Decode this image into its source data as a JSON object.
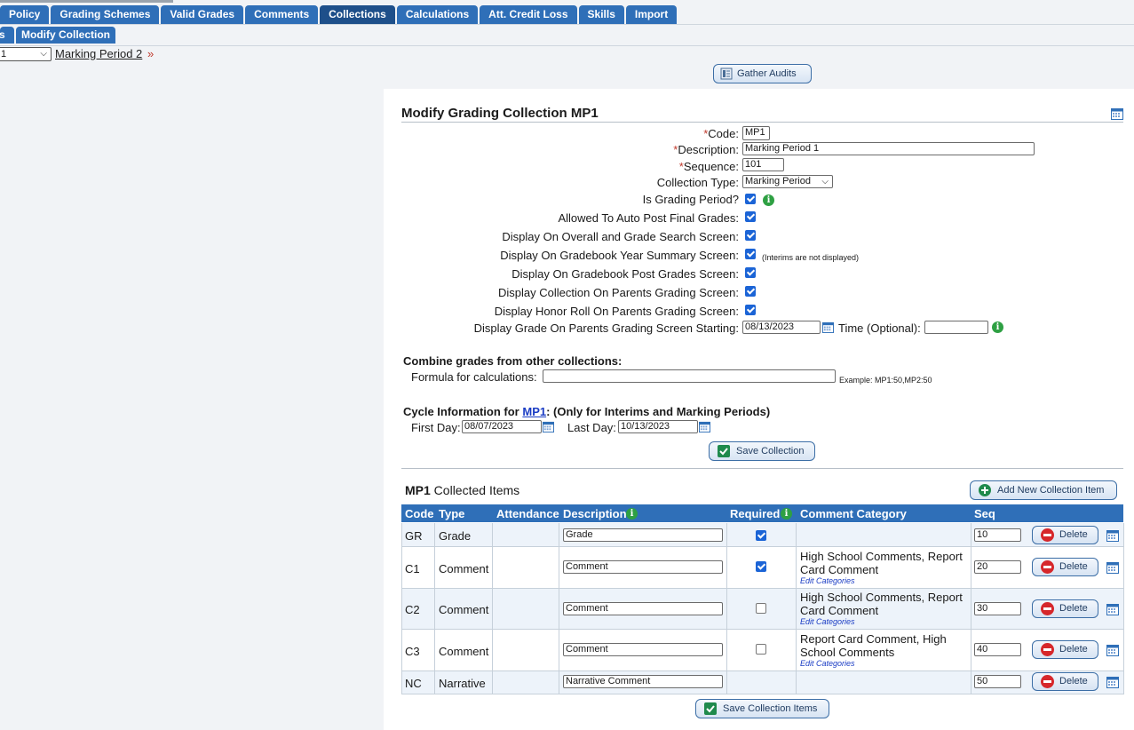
{
  "tabs": [
    "Policy",
    "Grading Schemes",
    "Valid Grades",
    "Comments",
    "Collections",
    "Calculations",
    "Att. Credit Loss",
    "Skills",
    "Import"
  ],
  "subtabs": {
    "partial": "s",
    "modify": "Modify Collection"
  },
  "nav": {
    "select_value": "1",
    "next_link": "Marking Period 2",
    "raquo": "»"
  },
  "buttons": {
    "gather_audits": "Gather Audits",
    "save_collection": "Save Collection",
    "add_item": "Add New Collection Item",
    "save_items": "Save Collection Items",
    "delete": "Delete"
  },
  "form": {
    "title": "Modify Grading Collection MP1",
    "code_label": "Code:",
    "code_value": "MP1",
    "desc_label": "Description:",
    "desc_value": "Marking Period 1",
    "seq_label": "Sequence:",
    "seq_value": "101",
    "type_label": "Collection Type:",
    "type_value": "Marking Period",
    "is_gp_label": "Is Grading Period?",
    "auto_post_label": "Allowed To Auto Post Final Grades:",
    "overall_label": "Display On Overall and Grade Search Screen:",
    "year_summary_label": "Display On Gradebook Year Summary Screen:",
    "interims_note": "(Interims are not displayed)",
    "post_grades_label": "Display On Gradebook Post Grades Screen:",
    "parents_label": "Display Collection On Parents Grading Screen:",
    "honor_label": "Display Honor Roll On Parents Grading Screen:",
    "starting_label": "Display Grade On Parents Grading Screen Starting:",
    "starting_value": "08/13/2023",
    "time_label": "Time (Optional):",
    "time_value": ""
  },
  "combine": {
    "title": "Combine grades from other collections:",
    "formula_label": "Formula for calculations:",
    "formula_value": "",
    "example": "Example: MP1:50,MP2:50"
  },
  "cycle": {
    "title_prefix": "Cycle Information for ",
    "link": "MP1",
    "title_suffix": ": (Only for Interims and Marking Periods)",
    "first_label": "First Day:",
    "first_value": "08/07/2023",
    "last_label": "Last Day:",
    "last_value": "10/13/2023"
  },
  "items": {
    "code": "MP1",
    "title": " Collected Items",
    "headers": [
      "Code",
      "Type",
      "Attendance",
      "Description",
      "Required",
      "Comment Category",
      "Seq"
    ],
    "rows": [
      {
        "code": "GR",
        "type": "Grade",
        "desc": "Grade",
        "required": true,
        "cat1": "",
        "cat2": "",
        "edit": "",
        "seq": "10"
      },
      {
        "code": "C1",
        "type": "Comment",
        "desc": "Comment",
        "required": true,
        "cat1": "High School Comments, Report",
        "cat2": "Card Comment",
        "edit": "Edit Categories",
        "seq": "20"
      },
      {
        "code": "C2",
        "type": "Comment",
        "desc": "Comment",
        "required": false,
        "cat1": "High School Comments, Report",
        "cat2": "Card Comment",
        "edit": "Edit Categories",
        "seq": "30"
      },
      {
        "code": "C3",
        "type": "Comment",
        "desc": "Comment",
        "required": false,
        "cat1": "Report Card Comment, High",
        "cat2": "School Comments",
        "edit": "Edit Categories",
        "seq": "40"
      },
      {
        "code": "NC",
        "type": "Narrative",
        "desc": "Narrative Comment",
        "required": null,
        "cat1": "",
        "cat2": "",
        "edit": "",
        "seq": "50"
      }
    ]
  },
  "colors": {
    "tab": "#2f6fb8",
    "tab_active": "#1e4f8a",
    "required_star": "#c0392b",
    "info": "#2ea043",
    "delete": "#d6272b"
  },
  "icons": {
    "calendar": "calendar-icon",
    "info": "info-icon",
    "check": "check-icon",
    "plus": "plus-circle-icon",
    "minus": "minus-circle-icon",
    "audit": "document-icon"
  }
}
